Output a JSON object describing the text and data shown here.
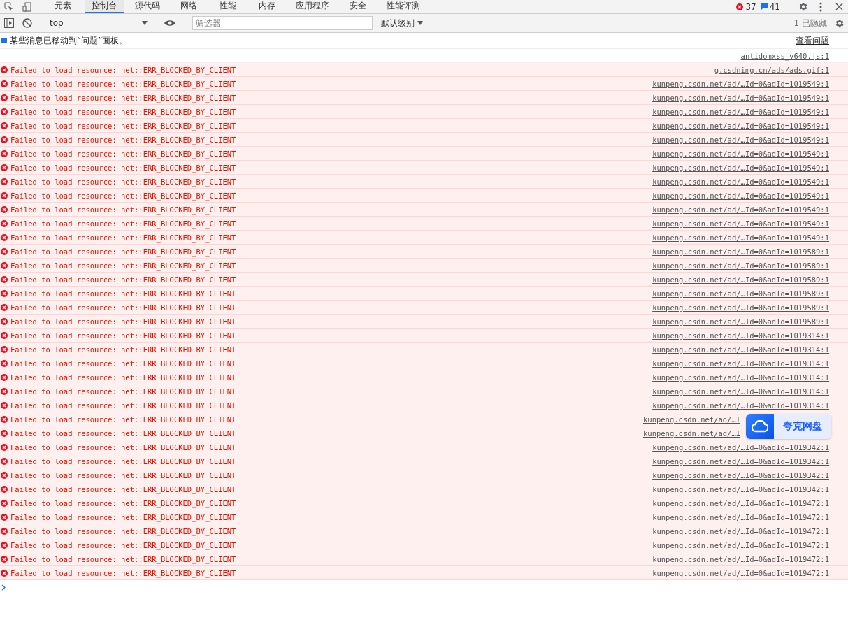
{
  "tabs": [
    {
      "label": "元素",
      "selected": false
    },
    {
      "label": "控制台",
      "selected": true
    },
    {
      "label": "源代码",
      "selected": false
    },
    {
      "label": "网络",
      "selected": false
    },
    {
      "label": "性能",
      "selected": false
    },
    {
      "label": "内存",
      "selected": false
    },
    {
      "label": "应用程序",
      "selected": false
    },
    {
      "label": "安全",
      "selected": false
    },
    {
      "label": "性能评测",
      "selected": false
    }
  ],
  "counts": {
    "errors": "37",
    "messages": "41"
  },
  "toolbar": {
    "context": "top",
    "filter": {
      "placeholder": "筛选器"
    },
    "level": "默认级别",
    "hidden": "1 已隐藏"
  },
  "banner": {
    "text": "某些消息已移动到“问题”面板。",
    "link": "查看问题"
  },
  "messages": [
    {
      "kind": "plain",
      "source": "antidomxss_v640.js:1"
    },
    {
      "kind": "error",
      "text": "Failed to load resource: net::ERR_BLOCKED_BY_CLIENT",
      "source": "g.csdnimg.cn/ads/ads.gif:1"
    },
    {
      "kind": "error",
      "text": "Failed to load resource: net::ERR_BLOCKED_BY_CLIENT",
      "source": "kunpeng.csdn.net/ad/…Id=0&adId=1019549:1"
    },
    {
      "kind": "error",
      "text": "Failed to load resource: net::ERR_BLOCKED_BY_CLIENT",
      "source": "kunpeng.csdn.net/ad/…Id=0&adId=1019549:1"
    },
    {
      "kind": "error",
      "text": "Failed to load resource: net::ERR_BLOCKED_BY_CLIENT",
      "source": "kunpeng.csdn.net/ad/…Id=0&adId=1019549:1"
    },
    {
      "kind": "error",
      "text": "Failed to load resource: net::ERR_BLOCKED_BY_CLIENT",
      "source": "kunpeng.csdn.net/ad/…Id=0&adId=1019549:1"
    },
    {
      "kind": "error",
      "text": "Failed to load resource: net::ERR_BLOCKED_BY_CLIENT",
      "source": "kunpeng.csdn.net/ad/…Id=0&adId=1019549:1"
    },
    {
      "kind": "error",
      "text": "Failed to load resource: net::ERR_BLOCKED_BY_CLIENT",
      "source": "kunpeng.csdn.net/ad/…Id=0&adId=1019549:1"
    },
    {
      "kind": "error",
      "text": "Failed to load resource: net::ERR_BLOCKED_BY_CLIENT",
      "source": "kunpeng.csdn.net/ad/…Id=0&adId=1019549:1"
    },
    {
      "kind": "error",
      "text": "Failed to load resource: net::ERR_BLOCKED_BY_CLIENT",
      "source": "kunpeng.csdn.net/ad/…Id=0&adId=1019549:1"
    },
    {
      "kind": "error",
      "text": "Failed to load resource: net::ERR_BLOCKED_BY_CLIENT",
      "source": "kunpeng.csdn.net/ad/…Id=0&adId=1019549:1"
    },
    {
      "kind": "error",
      "text": "Failed to load resource: net::ERR_BLOCKED_BY_CLIENT",
      "source": "kunpeng.csdn.net/ad/…Id=0&adId=1019549:1"
    },
    {
      "kind": "error",
      "text": "Failed to load resource: net::ERR_BLOCKED_BY_CLIENT",
      "source": "kunpeng.csdn.net/ad/…Id=0&adId=1019549:1"
    },
    {
      "kind": "error",
      "text": "Failed to load resource: net::ERR_BLOCKED_BY_CLIENT",
      "source": "kunpeng.csdn.net/ad/…Id=0&adId=1019549:1"
    },
    {
      "kind": "error",
      "text": "Failed to load resource: net::ERR_BLOCKED_BY_CLIENT",
      "source": "kunpeng.csdn.net/ad/…Id=0&adId=1019589:1"
    },
    {
      "kind": "error",
      "text": "Failed to load resource: net::ERR_BLOCKED_BY_CLIENT",
      "source": "kunpeng.csdn.net/ad/…Id=0&adId=1019589:1"
    },
    {
      "kind": "error",
      "text": "Failed to load resource: net::ERR_BLOCKED_BY_CLIENT",
      "source": "kunpeng.csdn.net/ad/…Id=0&adId=1019589:1"
    },
    {
      "kind": "error",
      "text": "Failed to load resource: net::ERR_BLOCKED_BY_CLIENT",
      "source": "kunpeng.csdn.net/ad/…Id=0&adId=1019589:1"
    },
    {
      "kind": "error",
      "text": "Failed to load resource: net::ERR_BLOCKED_BY_CLIENT",
      "source": "kunpeng.csdn.net/ad/…Id=0&adId=1019589:1"
    },
    {
      "kind": "error",
      "text": "Failed to load resource: net::ERR_BLOCKED_BY_CLIENT",
      "source": "kunpeng.csdn.net/ad/…Id=0&adId=1019589:1"
    },
    {
      "kind": "error",
      "text": "Failed to load resource: net::ERR_BLOCKED_BY_CLIENT",
      "source": "kunpeng.csdn.net/ad/…Id=0&adId=1019314:1"
    },
    {
      "kind": "error",
      "text": "Failed to load resource: net::ERR_BLOCKED_BY_CLIENT",
      "source": "kunpeng.csdn.net/ad/…Id=0&adId=1019314:1"
    },
    {
      "kind": "error",
      "text": "Failed to load resource: net::ERR_BLOCKED_BY_CLIENT",
      "source": "kunpeng.csdn.net/ad/…Id=0&adId=1019314:1"
    },
    {
      "kind": "error",
      "text": "Failed to load resource: net::ERR_BLOCKED_BY_CLIENT",
      "source": "kunpeng.csdn.net/ad/…Id=0&adId=1019314:1"
    },
    {
      "kind": "error",
      "text": "Failed to load resource: net::ERR_BLOCKED_BY_CLIENT",
      "source": "kunpeng.csdn.net/ad/…Id=0&adId=1019314:1"
    },
    {
      "kind": "error",
      "text": "Failed to load resource: net::ERR_BLOCKED_BY_CLIENT",
      "source": "kunpeng.csdn.net/ad/…Id=0&adId=1019314:1"
    },
    {
      "kind": "error",
      "text": "Failed to load resource: net::ERR_BLOCKED_BY_CLIENT",
      "source": "kunpeng.csdn.net/ad/…I",
      "covered": true
    },
    {
      "kind": "error",
      "text": "Failed to load resource: net::ERR_BLOCKED_BY_CLIENT",
      "source": "kunpeng.csdn.net/ad/…I",
      "covered": true
    },
    {
      "kind": "error",
      "text": "Failed to load resource: net::ERR_BLOCKED_BY_CLIENT",
      "source": "kunpeng.csdn.net/ad/…Id=0&adId=1019342:1"
    },
    {
      "kind": "error",
      "text": "Failed to load resource: net::ERR_BLOCKED_BY_CLIENT",
      "source": "kunpeng.csdn.net/ad/…Id=0&adId=1019342:1"
    },
    {
      "kind": "error",
      "text": "Failed to load resource: net::ERR_BLOCKED_BY_CLIENT",
      "source": "kunpeng.csdn.net/ad/…Id=0&adId=1019342:1"
    },
    {
      "kind": "error",
      "text": "Failed to load resource: net::ERR_BLOCKED_BY_CLIENT",
      "source": "kunpeng.csdn.net/ad/…Id=0&adId=1019342:1"
    },
    {
      "kind": "error",
      "text": "Failed to load resource: net::ERR_BLOCKED_BY_CLIENT",
      "source": "kunpeng.csdn.net/ad/…Id=0&adId=1019472:1"
    },
    {
      "kind": "error",
      "text": "Failed to load resource: net::ERR_BLOCKED_BY_CLIENT",
      "source": "kunpeng.csdn.net/ad/…Id=0&adId=1019472:1"
    },
    {
      "kind": "error",
      "text": "Failed to load resource: net::ERR_BLOCKED_BY_CLIENT",
      "source": "kunpeng.csdn.net/ad/…Id=0&adId=1019472:1"
    },
    {
      "kind": "error",
      "text": "Failed to load resource: net::ERR_BLOCKED_BY_CLIENT",
      "source": "kunpeng.csdn.net/ad/…Id=0&adId=1019472:1"
    },
    {
      "kind": "error",
      "text": "Failed to load resource: net::ERR_BLOCKED_BY_CLIENT",
      "source": "kunpeng.csdn.net/ad/…Id=0&adId=1019472:1"
    },
    {
      "kind": "error",
      "text": "Failed to load resource: net::ERR_BLOCKED_BY_CLIENT",
      "source": "kunpeng.csdn.net/ad/…Id=0&adId=1019472:1"
    }
  ],
  "floating_widget": {
    "label": "夸克网盘"
  }
}
